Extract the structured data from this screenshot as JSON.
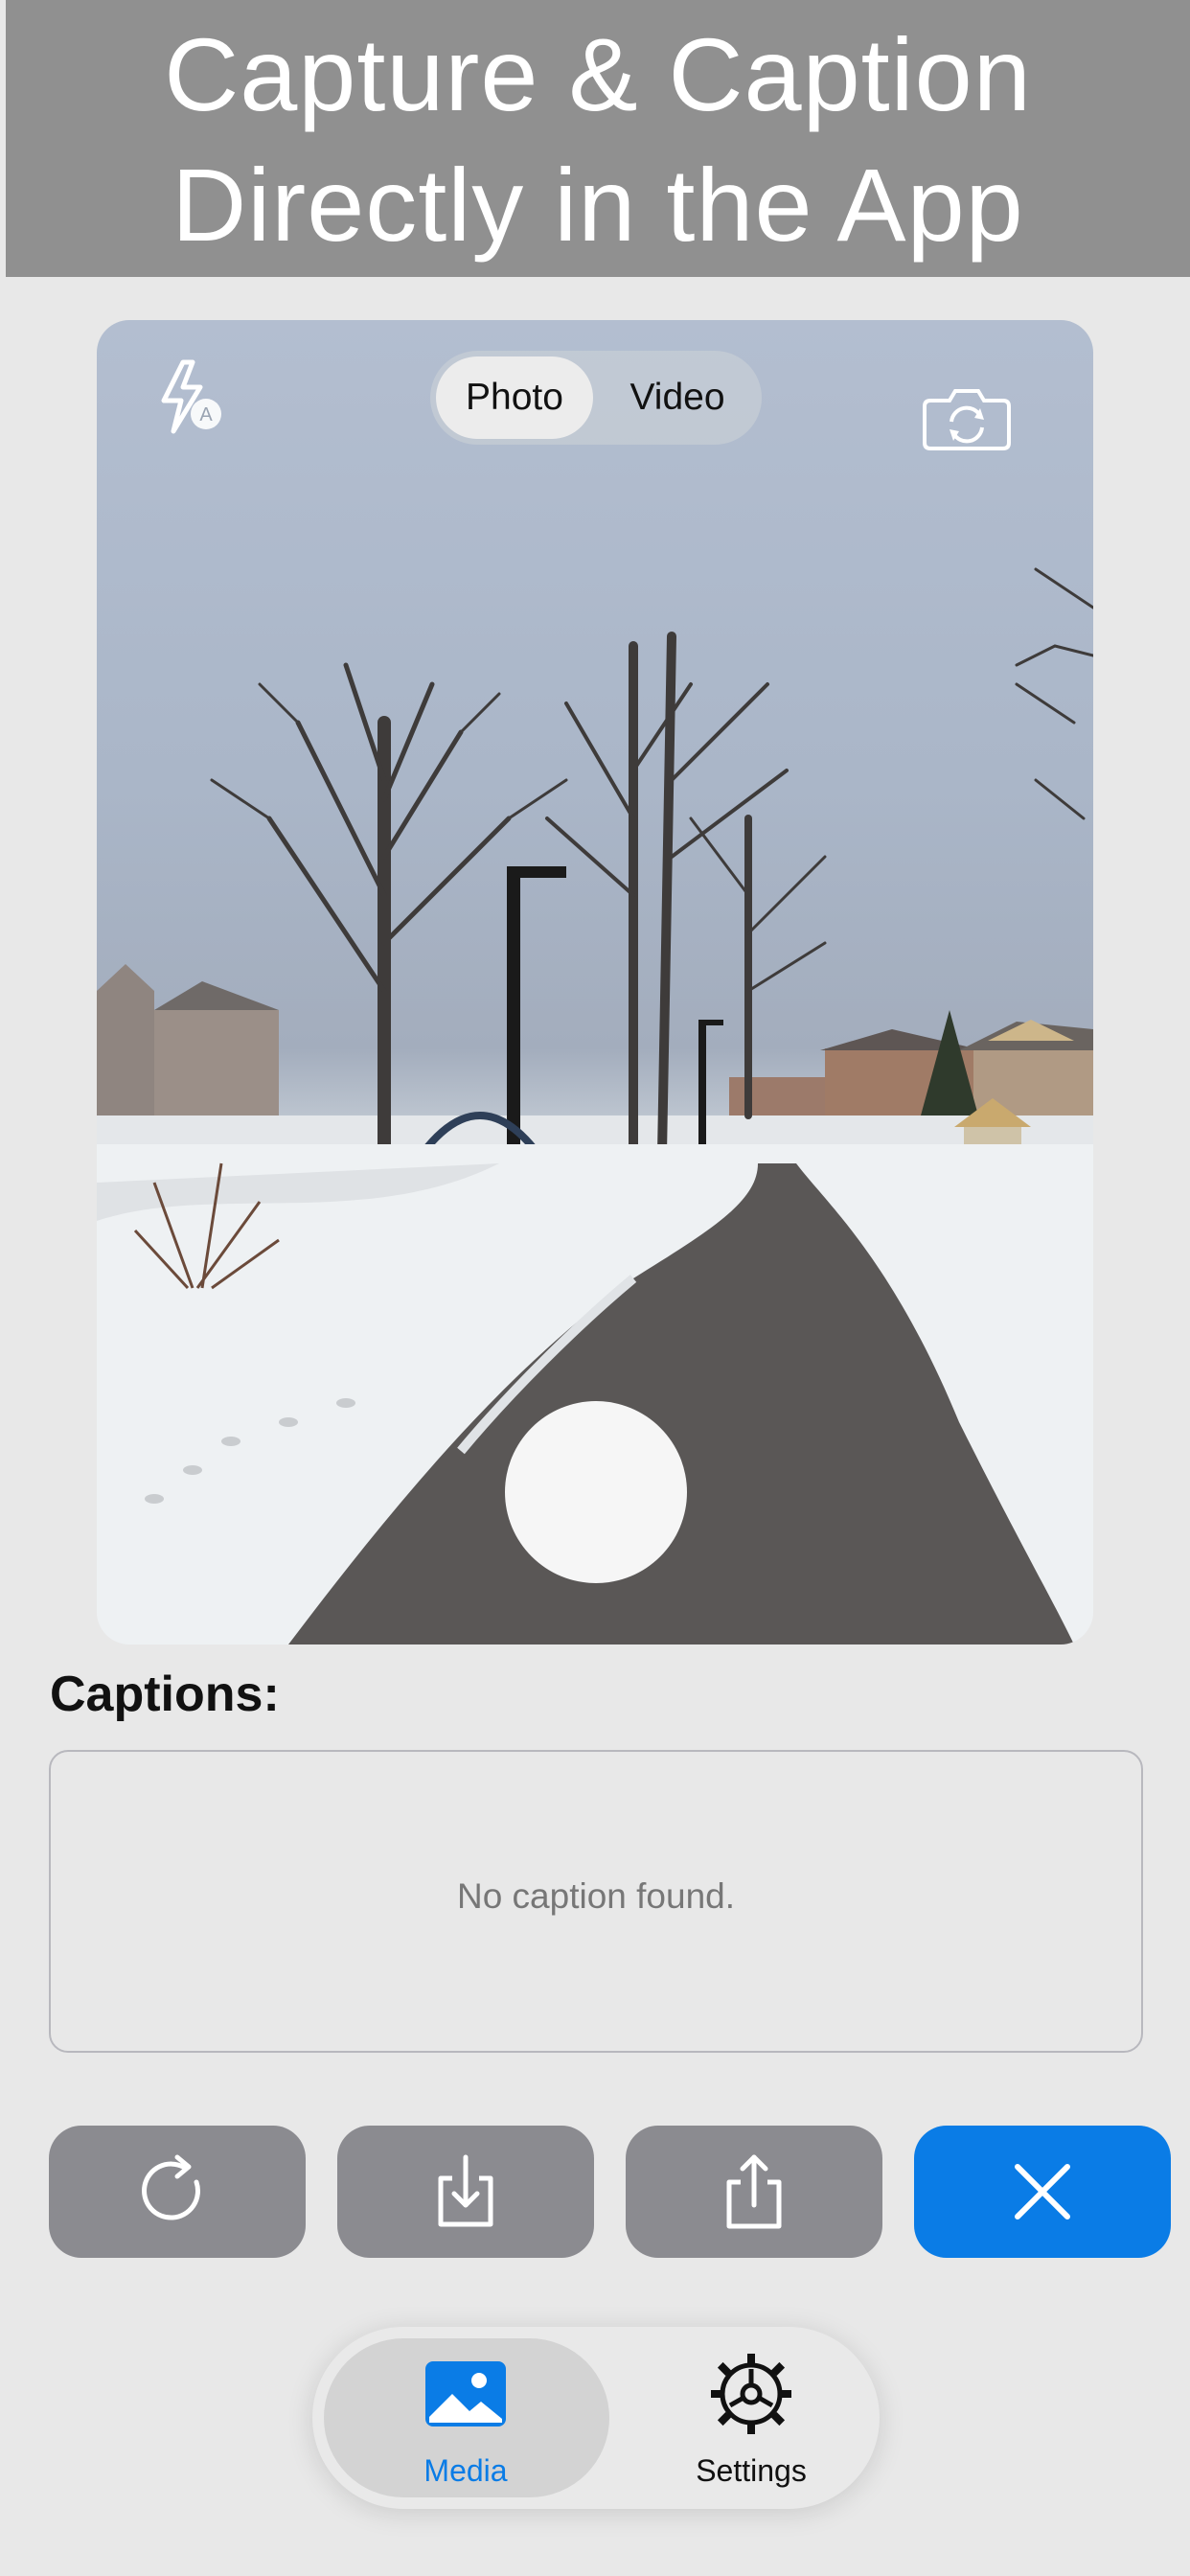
{
  "banner": {
    "line1": "Capture & Caption",
    "line2": "Directly in the App"
  },
  "camera": {
    "modes": [
      "Photo",
      "Video"
    ],
    "selected_mode": "Photo",
    "flash_icon": "flash-auto-icon",
    "flip_icon": "camera-flip-icon"
  },
  "captions": {
    "label": "Captions:",
    "empty_text": "No caption found."
  },
  "actions": [
    {
      "icon": "retry-icon"
    },
    {
      "icon": "download-icon"
    },
    {
      "icon": "share-icon"
    },
    {
      "icon": "close-icon"
    }
  ],
  "colors": {
    "accent": "#0a7ce6",
    "secondary_button": "#8b8b90",
    "banner": "#909090"
  },
  "tabbar": {
    "tabs": [
      {
        "label": "Media",
        "icon": "photo-icon",
        "active": true
      },
      {
        "label": "Settings",
        "icon": "gear-icon",
        "active": false
      }
    ]
  }
}
